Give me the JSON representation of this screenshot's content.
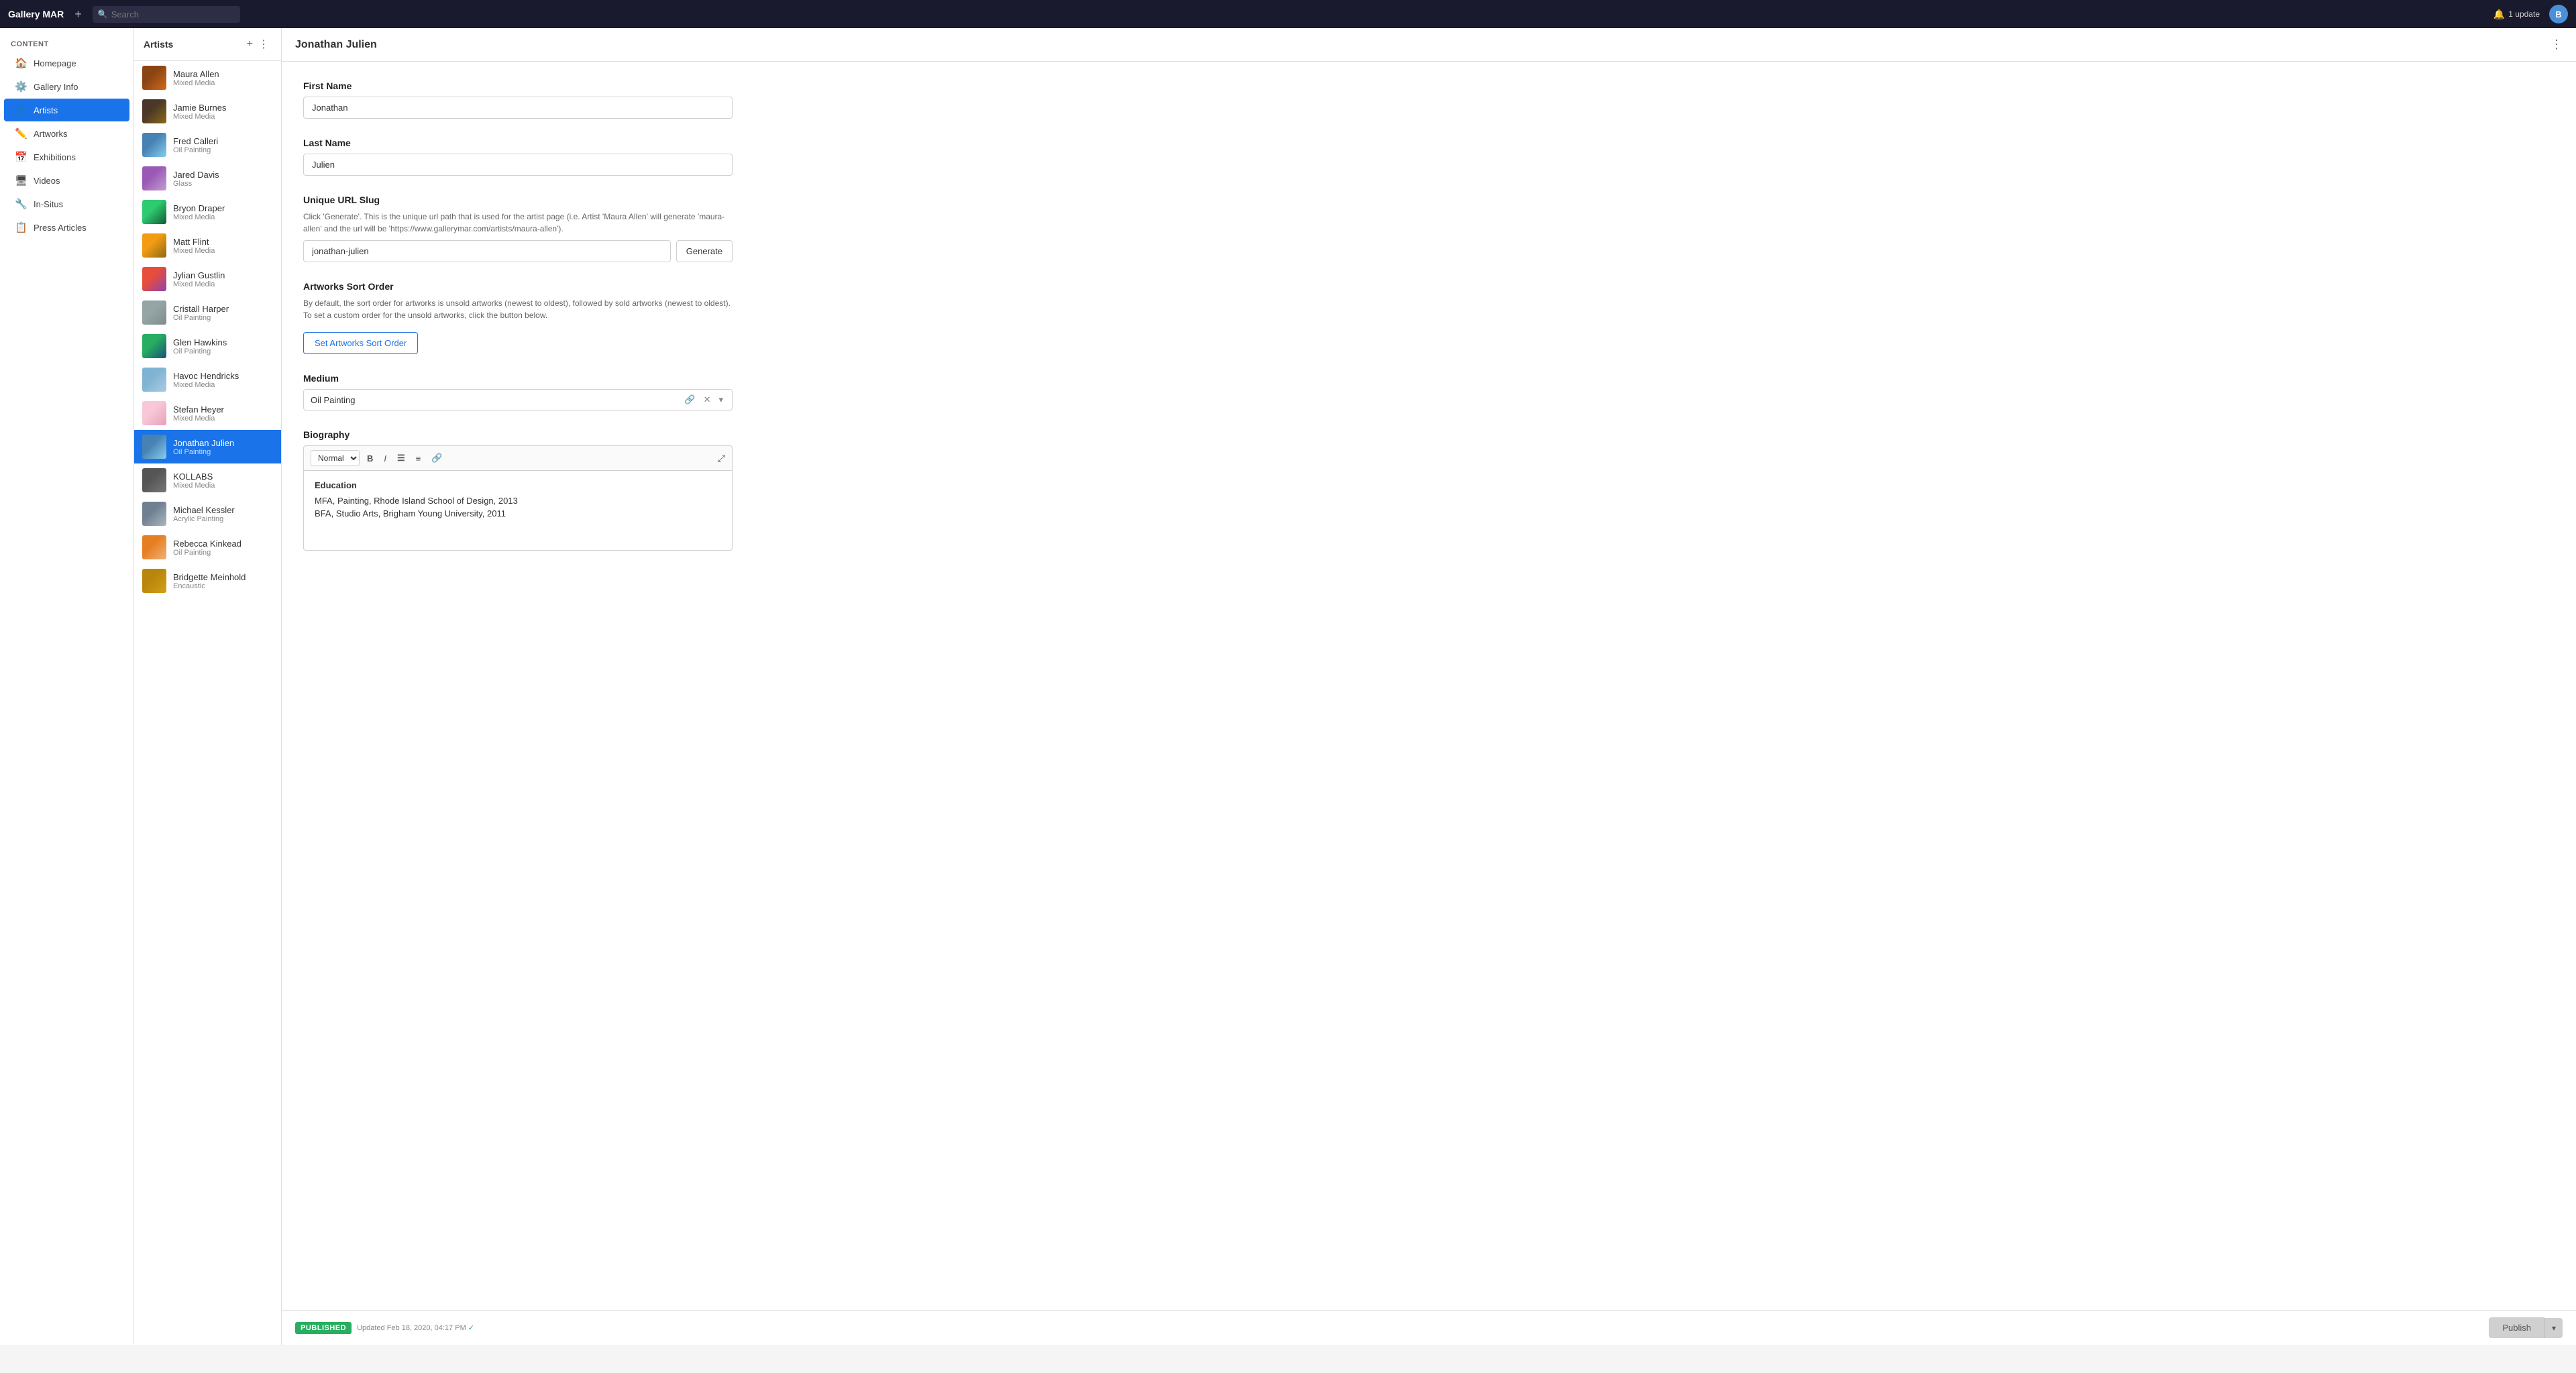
{
  "app": {
    "brand": "Gallery MAR",
    "update_label": "1 update",
    "avatar_letter": "B"
  },
  "topbar": {
    "search_placeholder": "Search"
  },
  "sidebar": {
    "section_label": "Content",
    "items": [
      {
        "id": "homepage",
        "label": "Homepage",
        "icon": "🏠"
      },
      {
        "id": "gallery-info",
        "label": "Gallery Info",
        "icon": "⚙️"
      },
      {
        "id": "artists",
        "label": "Artists",
        "icon": "👤",
        "active": true
      },
      {
        "id": "artworks",
        "label": "Artworks",
        "icon": "✏️"
      },
      {
        "id": "exhibitions",
        "label": "Exhibitions",
        "icon": "📅"
      },
      {
        "id": "videos",
        "label": "Videos",
        "icon": "🖥"
      },
      {
        "id": "in-situs",
        "label": "In-Situs",
        "icon": "🔧"
      },
      {
        "id": "press-articles",
        "label": "Press Articles",
        "icon": "📋"
      }
    ]
  },
  "artists_panel": {
    "title": "Artists",
    "add_btn_label": "+",
    "menu_btn_label": "⋮",
    "artists": [
      {
        "id": "maura-allen",
        "name": "Maura Allen",
        "medium": "Mixed Media",
        "thumb_class": "thumb-maura"
      },
      {
        "id": "jamie-burnes",
        "name": "Jamie Burnes",
        "medium": "Mixed Media",
        "thumb_class": "thumb-jamie"
      },
      {
        "id": "fred-calleri",
        "name": "Fred Calleri",
        "medium": "Oil Painting",
        "thumb_class": "thumb-fred"
      },
      {
        "id": "jared-davis",
        "name": "Jared Davis",
        "medium": "Glass",
        "thumb_class": "thumb-jared"
      },
      {
        "id": "bryon-draper",
        "name": "Bryon Draper",
        "medium": "Mixed Media",
        "thumb_class": "thumb-bryon"
      },
      {
        "id": "matt-flint",
        "name": "Matt Flint",
        "medium": "Mixed Media",
        "thumb_class": "thumb-matt"
      },
      {
        "id": "jylian-gustlin",
        "name": "Jylian Gustlin",
        "medium": "Mixed Media",
        "thumb_class": "thumb-jylian"
      },
      {
        "id": "cristall-harper",
        "name": "Cristall Harper",
        "medium": "Oil Painting",
        "thumb_class": "thumb-cristall"
      },
      {
        "id": "glen-hawkins",
        "name": "Glen Hawkins",
        "medium": "Oil Painting",
        "thumb_class": "thumb-glen"
      },
      {
        "id": "havoc-hendricks",
        "name": "Havoc Hendricks",
        "medium": "Mixed Media",
        "thumb_class": "thumb-havoc"
      },
      {
        "id": "stefan-heyer",
        "name": "Stefan Heyer",
        "medium": "Mixed Media",
        "thumb_class": "thumb-stefan"
      },
      {
        "id": "jonathan-julien",
        "name": "Jonathan Julien",
        "medium": "Oil Painting",
        "thumb_class": "thumb-jonathan",
        "active": true
      },
      {
        "id": "kollabs",
        "name": "KOLLABS",
        "medium": "Mixed Media",
        "thumb_class": "thumb-kollabs"
      },
      {
        "id": "michael-kessler",
        "name": "Michael Kessler",
        "medium": "Acrylic Painting",
        "thumb_class": "thumb-michael"
      },
      {
        "id": "rebecca-kinkead",
        "name": "Rebecca Kinkead",
        "medium": "Oil Painting",
        "thumb_class": "thumb-rebecca"
      },
      {
        "id": "bridgette-meinhold",
        "name": "Bridgette Meinhold",
        "medium": "Encaustic",
        "thumb_class": "thumb-bridgette"
      }
    ]
  },
  "detail": {
    "title": "Jonathan Julien",
    "menu_btn_label": "⋮",
    "first_name_label": "First Name",
    "first_name_value": "Jonathan",
    "last_name_label": "Last Name",
    "last_name_value": "Julien",
    "slug_label": "Unique URL Slug",
    "slug_hint": "Click 'Generate'. This is the unique url path that is used for the artist page (i.e. Artist 'Maura Allen' will generate 'maura-allen' and the url will be 'https://www.gallerymar.com/artists/maura-allen').",
    "slug_value": "jonathan-julien",
    "generate_btn": "Generate",
    "sort_order_label": "Artworks Sort Order",
    "sort_order_hint": "By default, the sort order for artworks is unsold artworks (newest to oldest), followed by sold artworks (newest to oldest). To set a custom order for the unsold artworks, click the button below.",
    "sort_order_btn": "Set Artworks Sort Order",
    "medium_label": "Medium",
    "medium_value": "Oil Painting",
    "biography_label": "Biography",
    "bio_format": "Normal",
    "bio_heading": "Education",
    "bio_line1": "MFA, Painting, Rhode Island School of Design, 2013",
    "bio_line2": "BFA, Studio Arts, Brigham Young University, 2011"
  },
  "bottom_bar": {
    "published_label": "PUBLISHED",
    "updated_text": "Updated Feb 18, 2020, 04:17 PM",
    "publish_btn": "Publish",
    "dropdown_btn": "▾"
  }
}
